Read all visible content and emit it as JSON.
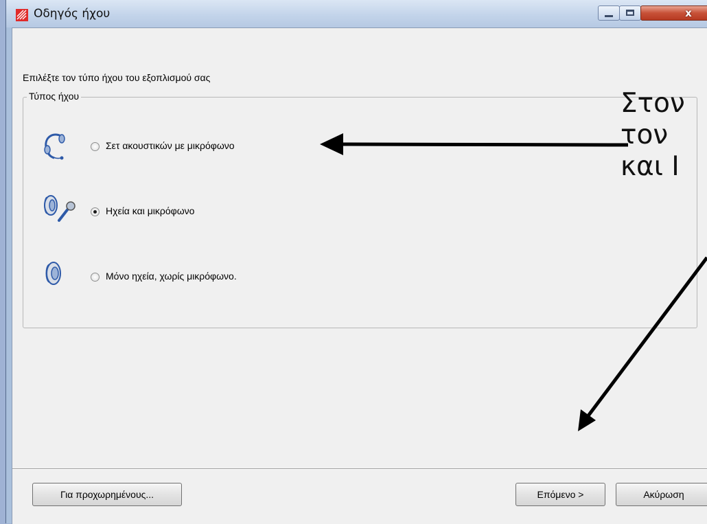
{
  "window": {
    "title": "Οδηγός ήχου",
    "controls": {
      "minimize": "minimize",
      "maximize": "maximize",
      "close_glyph": "x"
    }
  },
  "dialog": {
    "instruction": "Επιλέξτε τον τύπο ήχου του εξοπλισμού σας",
    "group_label": "Τύπος ήχου",
    "options": [
      {
        "label": "Σετ ακουστικών με μικρόφωνο",
        "icon": "headset-icon",
        "selected": false
      },
      {
        "label": "Ηχεία και μικρόφωνο",
        "icon": "speaker-microphone-icon",
        "selected": true
      },
      {
        "label": "Μόνο ηχεία, χωρίς μικρόφωνο.",
        "icon": "speaker-icon",
        "selected": false
      }
    ]
  },
  "buttons": {
    "advanced": "Για προχωρημένους...",
    "next": "Επόμενο >",
    "cancel": "Ακύρωση"
  },
  "annotation": {
    "lines": [
      "Στον",
      "τον",
      "και Ι"
    ]
  },
  "colors": {
    "titlebar": "#c3d4ea",
    "client_bg": "#f0f0f0",
    "close_button": "#c75137"
  }
}
